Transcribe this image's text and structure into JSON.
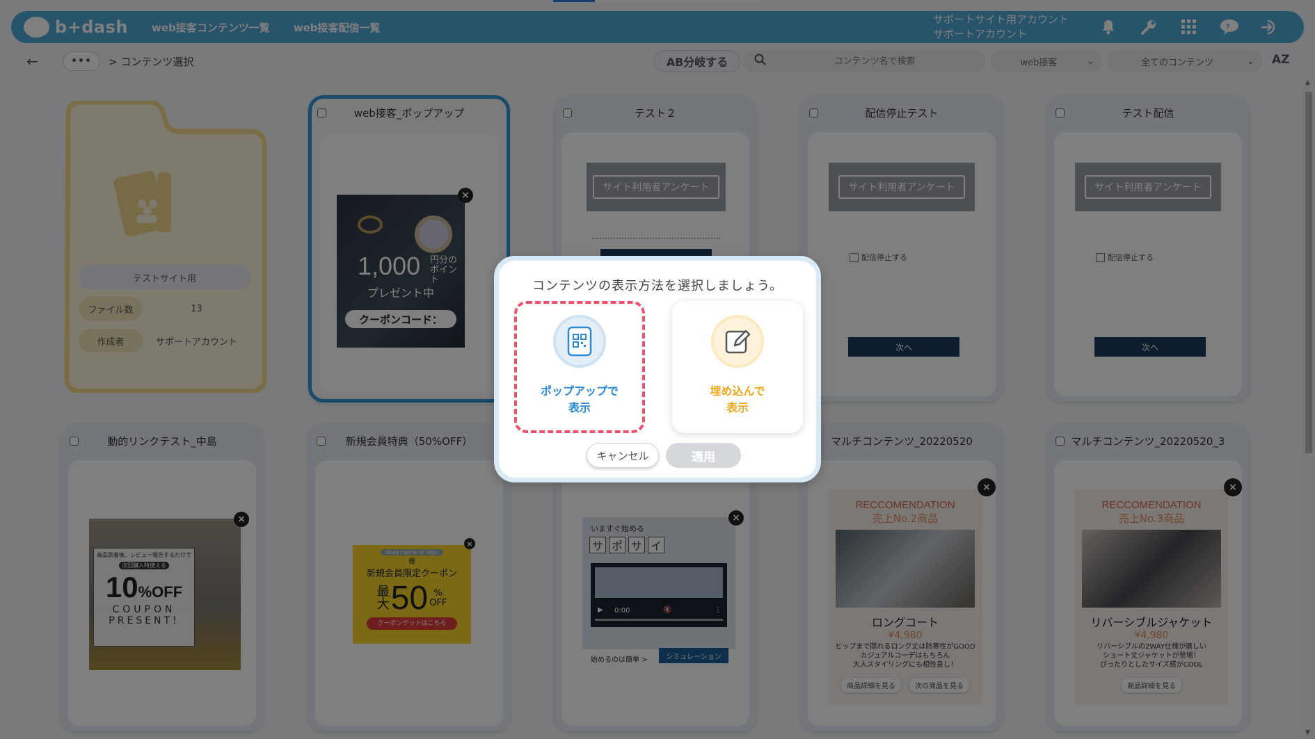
{
  "app": {
    "logo_text": "b+dash",
    "nav_links": [
      "web接客コンテンツ一覧",
      "web接客配信一覧"
    ],
    "account_line1": "サポートサイト用アカウント",
    "account_line2": "サポートアカウント"
  },
  "subbar": {
    "breadcrumb_more": "•••",
    "breadcrumb_current": "> コンテンツ選択",
    "ab_button": "AB分岐する",
    "search_placeholder": "コンテンツ名で検索",
    "filter_type": "web接客",
    "filter_contents": "全てのコンテンツ",
    "sort_label": "AZ"
  },
  "folder": {
    "name": "テストサイト用",
    "file_count_label": "ファイル数",
    "file_count_value": "13",
    "creator_label": "作成者",
    "creator_value": "サポートアカウント"
  },
  "cards": {
    "c1": {
      "title": "web接客_ポップアップ",
      "amount": "1,000",
      "unit_small1": "円分の",
      "unit_small2": "ポイント",
      "present": "プレゼント中",
      "coupon": "クーポンコード："
    },
    "c2": {
      "title": "テスト２",
      "survey": "サイト利用者アンケート"
    },
    "c3": {
      "title": "配信停止テスト",
      "survey": "サイト利用者アンケート",
      "stop_label": "配信停止する",
      "next": "次へ"
    },
    "c4": {
      "title": "テスト配信",
      "survey": "サイト利用者アンケート",
      "stop_label": "配信停止する",
      "next": "次へ"
    },
    "c5": {
      "title": "動的リンクテスト_中島",
      "top_text": "商品到着後、レビュー報告するだけで",
      "sub_text": "次回購入時使える",
      "percent": "10",
      "off": "%OFF",
      "coupon": "COUPON",
      "present": "PRESENT!"
    },
    "c6": {
      "title": "新規会員特典（50%OFF）",
      "shop": "shop name or logo",
      "sama": "様",
      "headline": "新規会員限定クーポン",
      "max1": "最",
      "max2": "大",
      "pct": "50",
      "pct_unit": "%",
      "off": "OFF",
      "cta": "クーポンゲットはこちら"
    },
    "c7": {
      "title": "",
      "start": "いますぐ始める",
      "kana": [
        "サ",
        "ポ",
        "サ",
        "イ"
      ],
      "time": "0:00",
      "easy": "始めるのは簡単 >",
      "sim": "シミュレーション"
    },
    "c8": {
      "title": "マルチコンテンツ_20220520",
      "reco": "RECCOMENDATION",
      "rank": "売上No.2商品",
      "name": "ロングコート",
      "price": "¥4,980",
      "desc1": "ヒップまで隠れるロング丈は防寒性がGOOD",
      "desc2": "カジュアルコーデはもちろん",
      "desc3": "大人スタイリングにも相性良し！",
      "btn1": "商品詳細を見る",
      "btn2": "次の商品を見る"
    },
    "c9": {
      "title": "マルチコンテンツ_20220520_3",
      "reco": "RECCOMENDATION",
      "rank": "売上No.3商品",
      "name": "リバーシブルジャケット",
      "price": "¥4,980",
      "desc1": "リバーシブルの2WAY仕様が嬉しい",
      "desc2": "ショート丈ジャケットが登場！",
      "desc3": "ぴったりとしたサイズ感がCOOL",
      "btn1": "商品詳細を見る"
    }
  },
  "modal": {
    "title": "コンテンツの表示方法を選択しましょう。",
    "popup_line1": "ポップアップで",
    "popup_line2": "表示",
    "embed_line1": "埋め込んで",
    "embed_line2": "表示",
    "cancel": "キャンセル",
    "apply": "適用"
  },
  "colors": {
    "brand": "#4ea6d6",
    "popup_accent": "#2a8ad4",
    "embed_accent": "#f0a81c",
    "dashed": "#f0506e",
    "folder": "#f4d98a"
  }
}
